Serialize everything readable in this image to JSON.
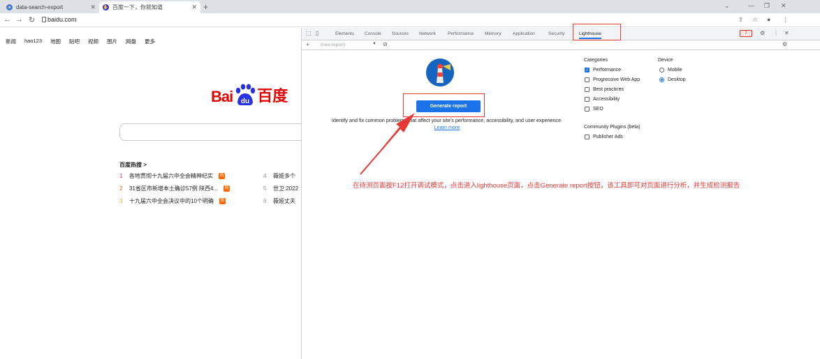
{
  "tabs": [
    {
      "title": "data-search-export"
    },
    {
      "title": "百度一下，你就知道"
    }
  ],
  "address": {
    "url": "baidu.com"
  },
  "baidu": {
    "nav": [
      "新闻",
      "hao123",
      "地图",
      "贴吧",
      "视频",
      "图片",
      "网盘",
      "更多"
    ],
    "logo_left": "Bai",
    "logo_mid": "du",
    "logo_right": "百度",
    "hot_title": "百度热搜 >",
    "hot_items": [
      {
        "num": "1",
        "text": "各地贯彻十九届六中全会精神纪实",
        "badge": "热"
      },
      {
        "num": "2",
        "text": "31省区市新增本土确诊57例 陕西4...",
        "badge": "热"
      },
      {
        "num": "3",
        "text": "十九届六中全会决议中的10个明确",
        "badge": "热"
      },
      {
        "num": "4",
        "text": "薇娅多个"
      },
      {
        "num": "5",
        "text": "世卫:2022"
      },
      {
        "num": "6",
        "text": "薇娅丈夫"
      }
    ]
  },
  "devtools": {
    "tabs": [
      "Elements",
      "Console",
      "Sources",
      "Network",
      "Performance",
      "Memory",
      "Application",
      "Security",
      "Lighthouse"
    ],
    "issues_count": "7",
    "sub_placeholder": "(new report)",
    "generate_label": "Generate report",
    "desc_text": "Identify and fix common problems that affect your site's performance, accessibility, and user experience.",
    "learn_more": "Learn more",
    "categories_title": "Categories",
    "categories": [
      {
        "label": "Performance",
        "checked": true
      },
      {
        "label": "Progressive Web App",
        "checked": false
      },
      {
        "label": "Best practices",
        "checked": false
      },
      {
        "label": "Accessibility",
        "checked": false
      },
      {
        "label": "SEO",
        "checked": false
      }
    ],
    "device_title": "Device",
    "devices": [
      {
        "label": "Mobile",
        "selected": false
      },
      {
        "label": "Desktop",
        "selected": true
      }
    ],
    "plugins_title": "Community Plugins (beta)",
    "plugins": [
      {
        "label": "Publisher Ads",
        "checked": false
      }
    ]
  },
  "annotation": "在待测页面按F12打开调试模式，点击进入lighthouse页面，点击Generate report按钮，该工具即可对页面进行分析，并生成检测报告",
  "colors": {
    "annotation": "#e53935",
    "accent": "#1a73e8",
    "baidu_red": "#e10601"
  }
}
